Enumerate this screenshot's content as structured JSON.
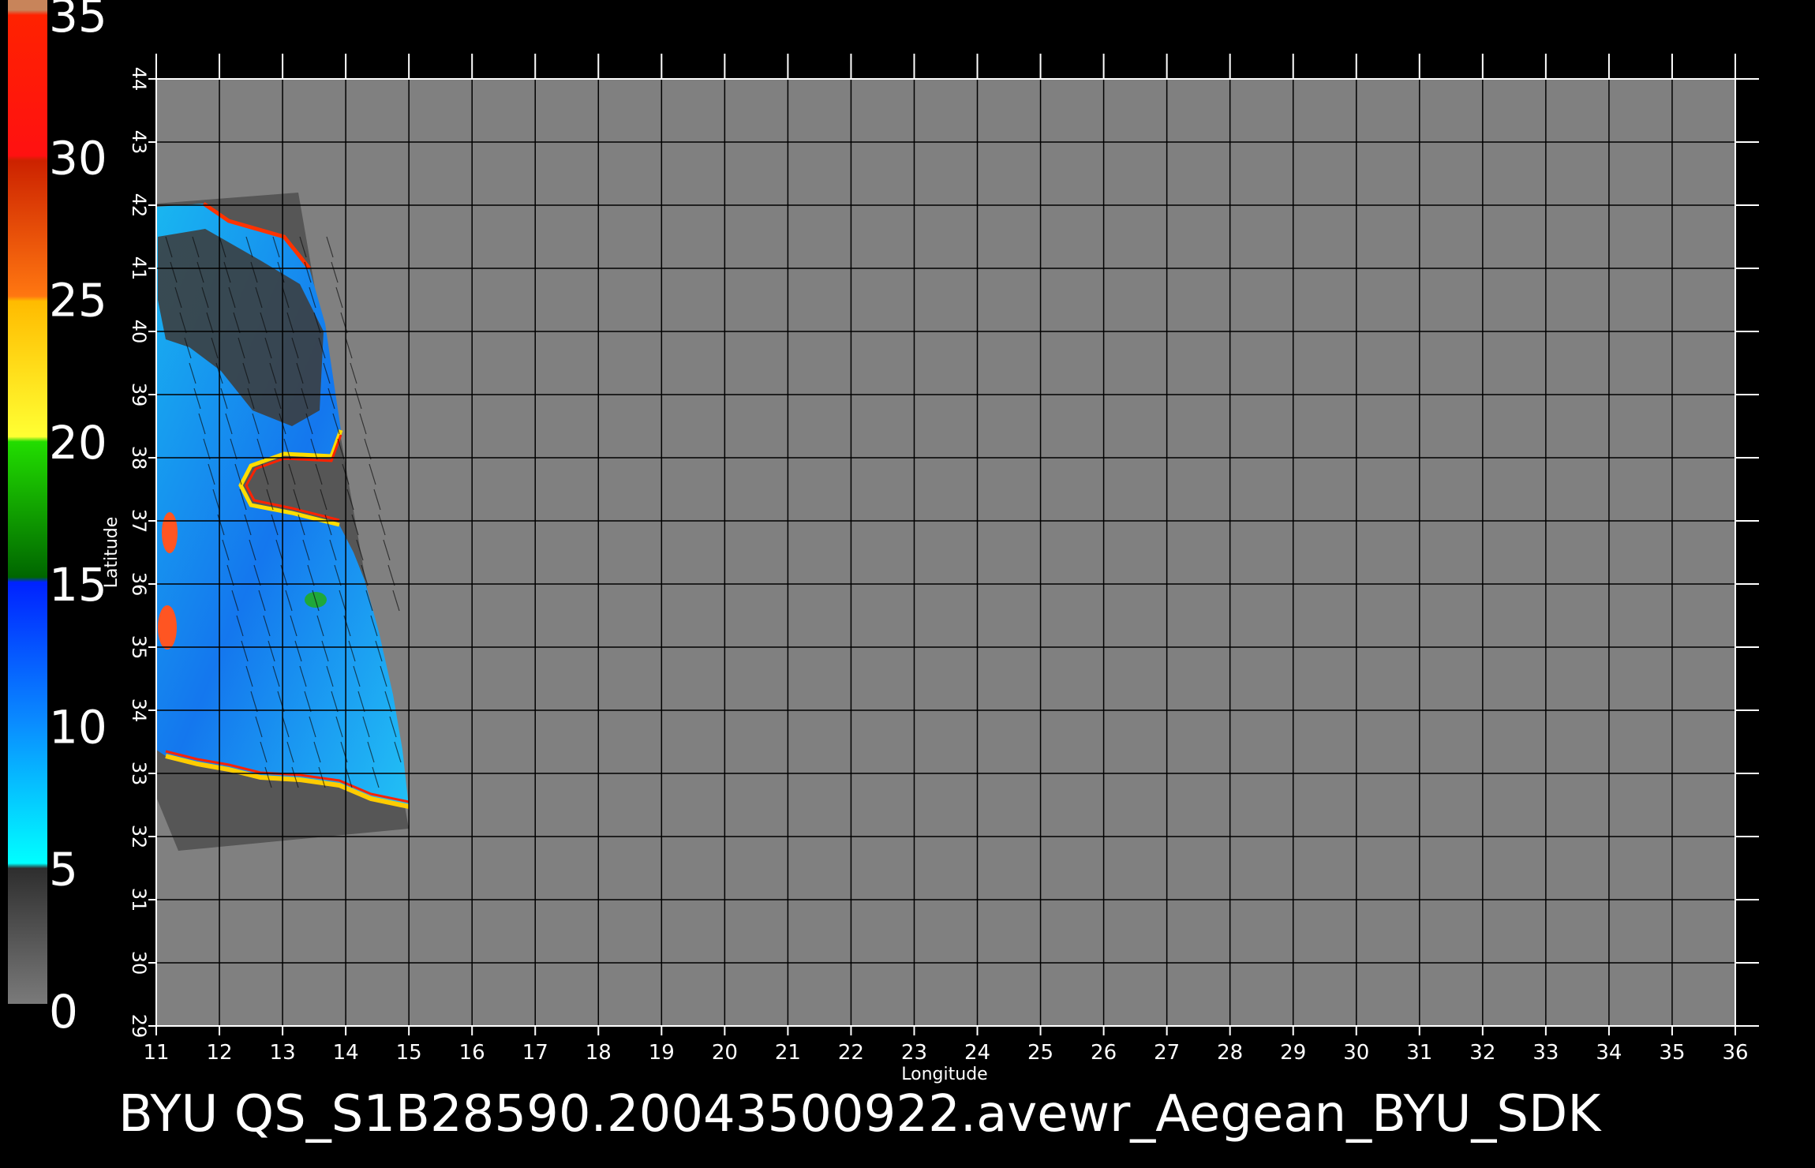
{
  "colorbar": {
    "labels": [
      "35",
      "30",
      "25",
      "20",
      "15",
      "10",
      "5",
      "0"
    ]
  },
  "map": {
    "xlabel": "Longitude",
    "ylabel": "Latitude",
    "lon_range": [
      11,
      36
    ],
    "lat_range": [
      29,
      44
    ],
    "lon_ticks": [
      "11",
      "12",
      "13",
      "14",
      "15",
      "16",
      "17",
      "18",
      "19",
      "20",
      "21",
      "22",
      "23",
      "24",
      "25",
      "26",
      "27",
      "28",
      "29",
      "30",
      "31",
      "32",
      "33",
      "34",
      "35",
      "36"
    ],
    "lat_ticks": [
      "29",
      "30",
      "31",
      "32",
      "33",
      "34",
      "35",
      "36",
      "37",
      "38",
      "39",
      "40",
      "41",
      "42",
      "43",
      "44"
    ],
    "background_color": "#808080",
    "grid_color": "#000000"
  },
  "caption": "BYU  QS_S1B28590.20043500922.avewr_Aegean_BYU_SDK"
}
